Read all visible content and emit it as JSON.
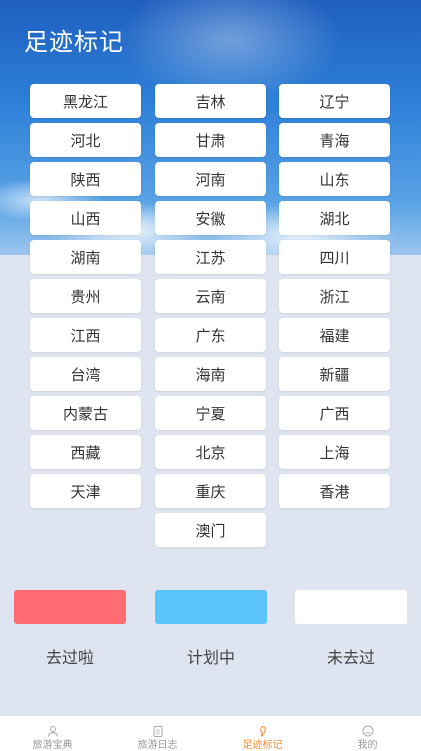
{
  "header": {
    "title": "足迹标记"
  },
  "provinces": [
    [
      "黑龙江",
      "吉林",
      "辽宁"
    ],
    [
      "河北",
      "甘肃",
      "青海"
    ],
    [
      "陕西",
      "河南",
      "山东"
    ],
    [
      "山西",
      "安徽",
      "湖北"
    ],
    [
      "湖南",
      "江苏",
      "四川"
    ],
    [
      "贵州",
      "云南",
      "浙江"
    ],
    [
      "江西",
      "广东",
      "福建"
    ],
    [
      "台湾",
      "海南",
      "新疆"
    ],
    [
      "内蒙古",
      "宁夏",
      "广西"
    ],
    [
      "西藏",
      "北京",
      "上海"
    ],
    [
      "天津",
      "重庆",
      "香港"
    ],
    [
      "",
      "澳门",
      ""
    ]
  ],
  "legend": [
    {
      "label": "去过啦",
      "color": "#fe6b71"
    },
    {
      "label": "计划中",
      "color": "#5bc5fa"
    },
    {
      "label": "未去过",
      "color": "#ffffff"
    }
  ],
  "tabs": [
    {
      "label": "旅游宝典",
      "icon": "user-icon",
      "active": false
    },
    {
      "label": "旅游日志",
      "icon": "clipboard-icon",
      "active": false
    },
    {
      "label": "足迹标记",
      "icon": "footprint-icon",
      "active": true
    },
    {
      "label": "我的",
      "icon": "smile-icon",
      "active": false
    }
  ]
}
